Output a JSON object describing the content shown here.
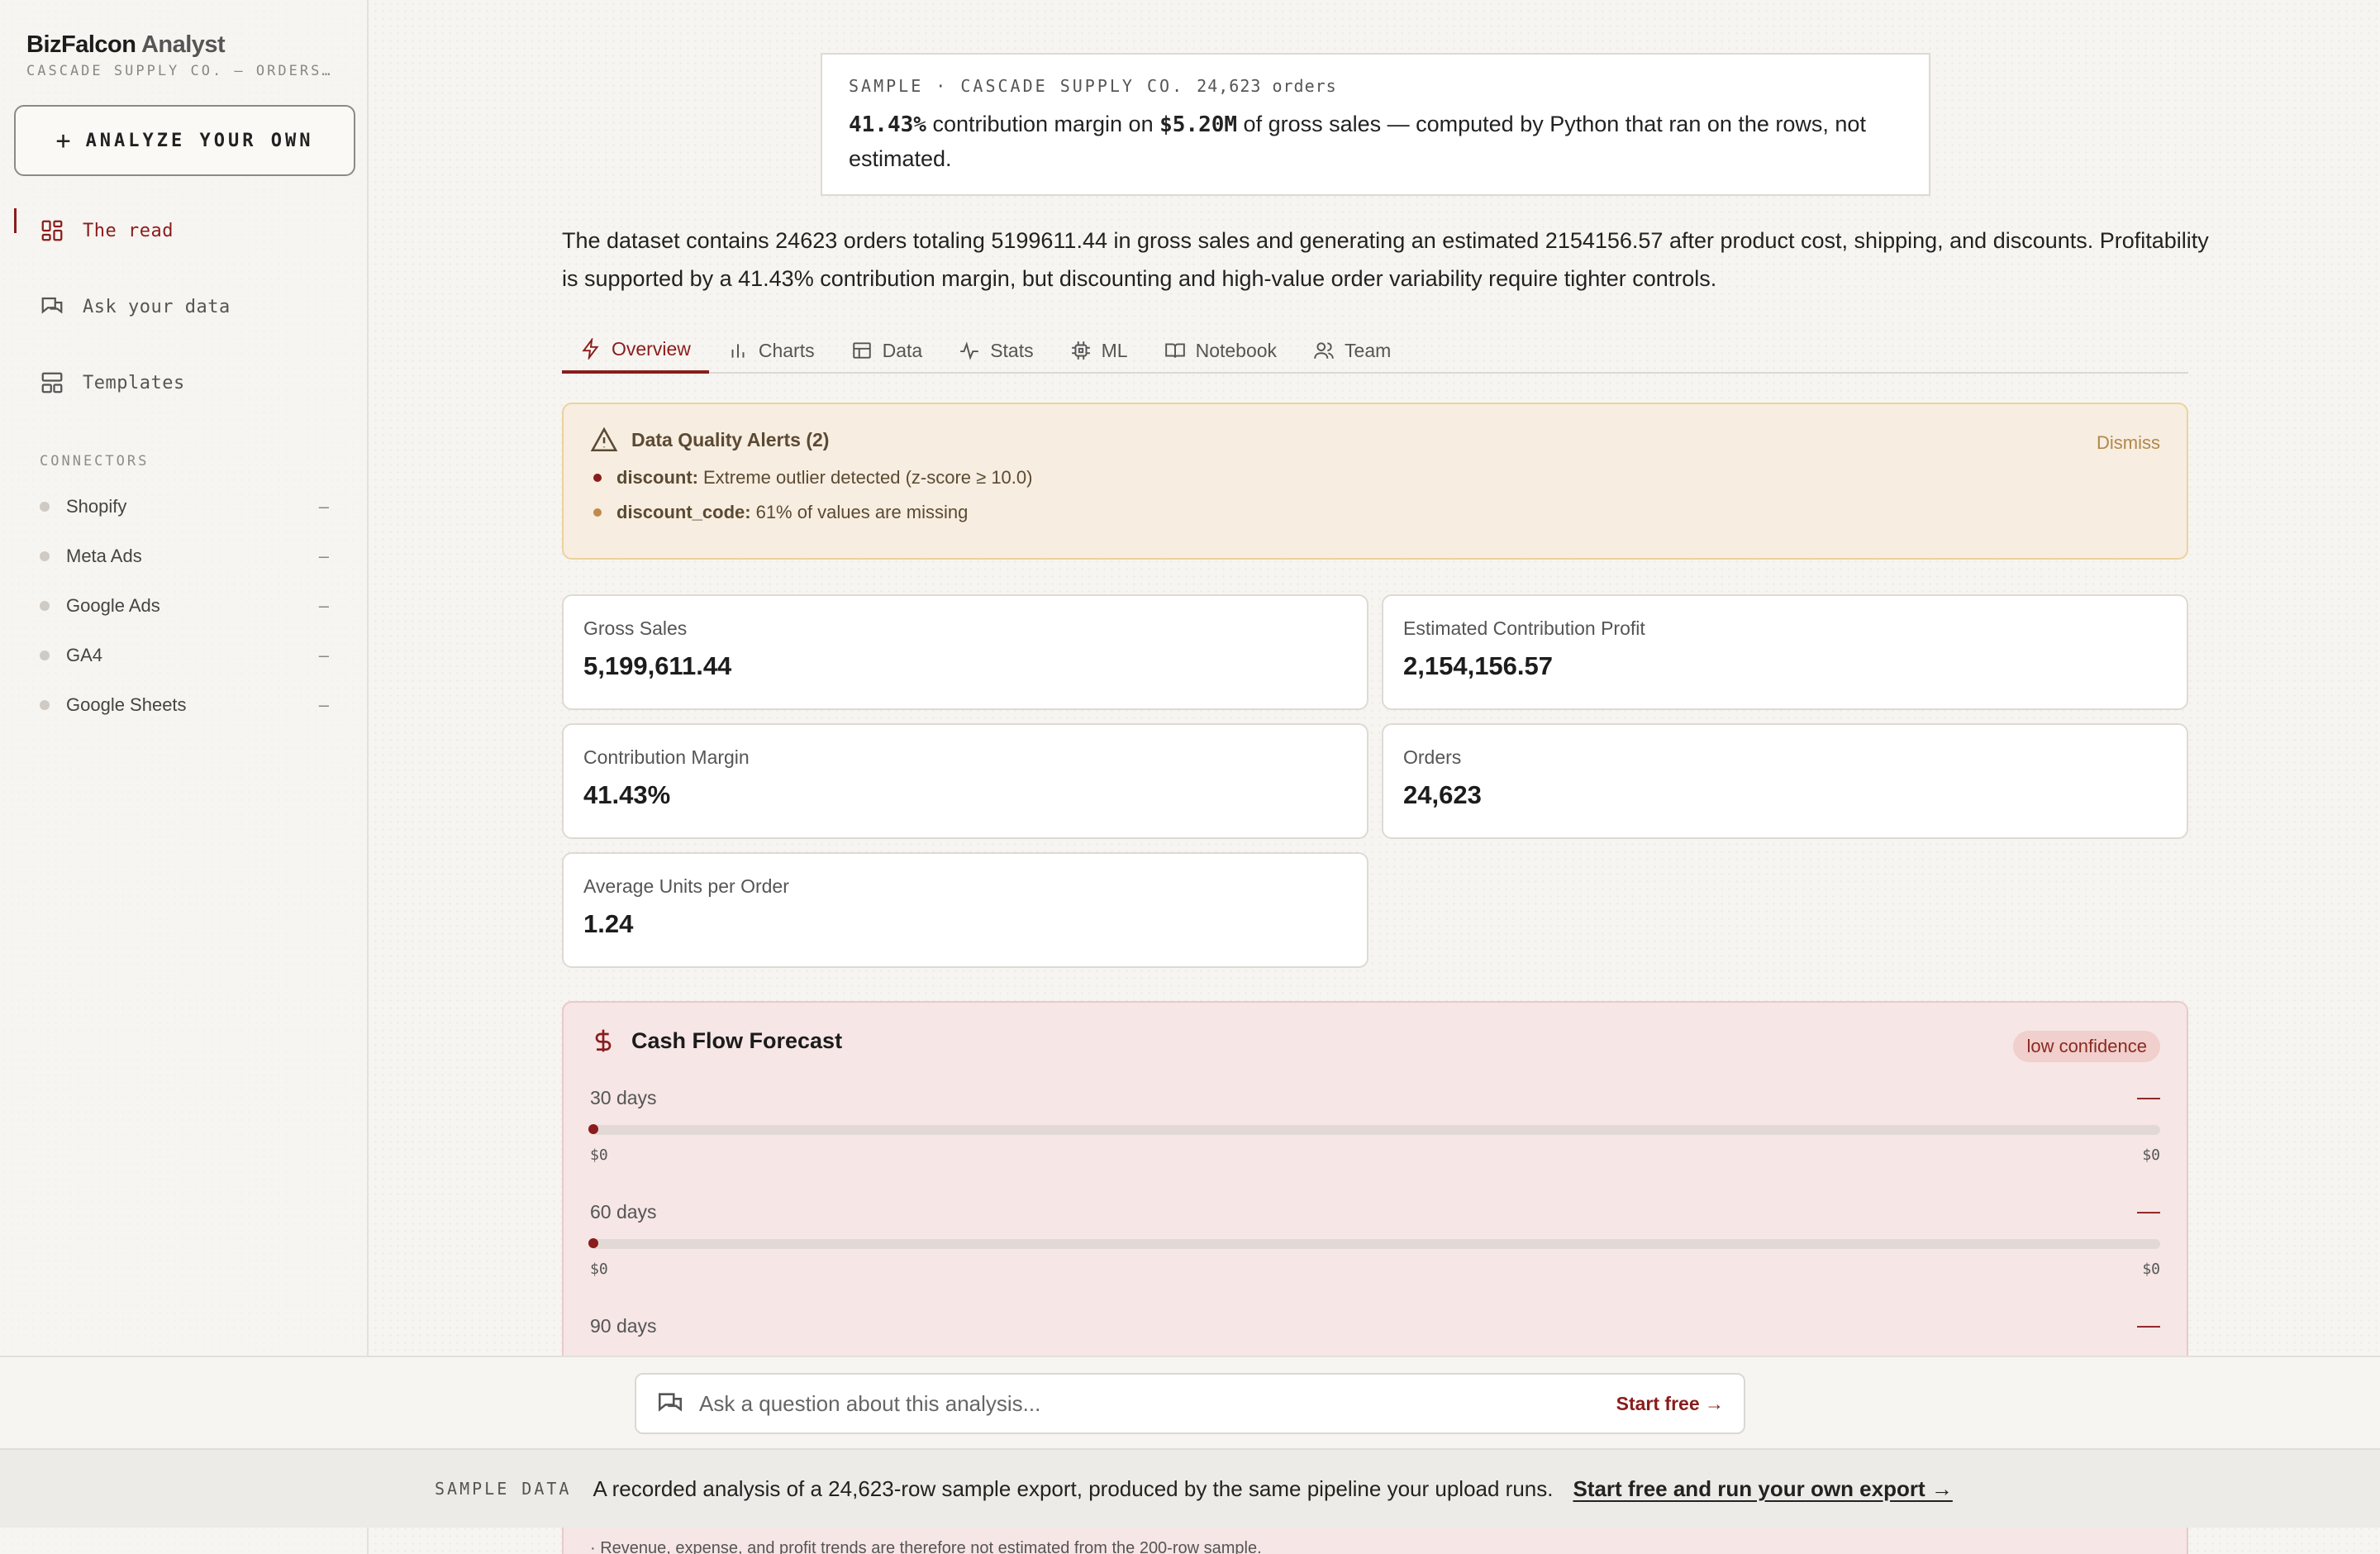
{
  "sidebar": {
    "brand_bold": "BizFalcon",
    "brand_light": "Analyst",
    "subtitle": "CASCADE SUPPLY CO. — ORDERS…",
    "analyze_label": "ANALYZE YOUR OWN",
    "nav": [
      {
        "label": "The read",
        "icon": "grid-icon",
        "active": true
      },
      {
        "label": "Ask your data",
        "icon": "chat-icon",
        "active": false
      },
      {
        "label": "Templates",
        "icon": "templates-icon",
        "active": false
      }
    ],
    "connectors_title": "CONNECTORS",
    "connectors": [
      {
        "name": "Shopify",
        "status": "–"
      },
      {
        "name": "Meta Ads",
        "status": "–"
      },
      {
        "name": "Google Ads",
        "status": "–"
      },
      {
        "name": "GA4",
        "status": "–"
      },
      {
        "name": "Google Sheets",
        "status": "–"
      }
    ]
  },
  "sample": {
    "head": "SAMPLE · CASCADE SUPPLY CO.",
    "count": "24,623 orders",
    "margin": "41.43%",
    "text1": "contribution margin on",
    "gross": "$5.20M",
    "text2": "of gross sales — computed by Python that ran on the rows, not estimated."
  },
  "summary": "The dataset contains 24623 orders totaling 5199611.44 in gross sales and generating an estimated 2154156.57 after product cost, shipping, and discounts. Profitability is supported by a 41.43% contribution margin, but discounting and high-value order variability require tighter controls.",
  "tabs": [
    {
      "label": "Overview",
      "icon": "bolt-icon",
      "active": true
    },
    {
      "label": "Charts",
      "icon": "bar-chart-icon",
      "active": false
    },
    {
      "label": "Data",
      "icon": "table-icon",
      "active": false
    },
    {
      "label": "Stats",
      "icon": "pulse-icon",
      "active": false
    },
    {
      "label": "ML",
      "icon": "chip-icon",
      "active": false
    },
    {
      "label": "Notebook",
      "icon": "book-icon",
      "active": false
    },
    {
      "label": "Team",
      "icon": "users-icon",
      "active": false
    }
  ],
  "alerts": {
    "title": "Data Quality Alerts (2)",
    "dismiss": "Dismiss",
    "items": [
      {
        "field": "discount:",
        "text": "Extreme outlier detected (z-score ≥ 10.0)",
        "color": "#8a1c1c"
      },
      {
        "field": "discount_code:",
        "text": "61% of values are missing",
        "color": "#c08a4a"
      }
    ]
  },
  "kpis": [
    {
      "label": "Gross Sales",
      "value": "5,199,611.44"
    },
    {
      "label": "Estimated Contribution Profit",
      "value": "2,154,156.57"
    },
    {
      "label": "Contribution Margin",
      "value": "41.43%"
    },
    {
      "label": "Orders",
      "value": "24,623"
    },
    {
      "label": "Average Units per Order",
      "value": "1.24"
    }
  ],
  "forecast": {
    "title": "Cash Flow Forecast",
    "confidence": "low confidence",
    "rows": [
      {
        "label": "30 days",
        "value": "—",
        "min": "$0",
        "max": "$0"
      },
      {
        "label": "60 days",
        "value": "—",
        "min": "$0",
        "max": "$0"
      },
      {
        "label": "90 days",
        "value": "—"
      }
    ]
  },
  "ask": {
    "placeholder": "Ask a question about this analysis...",
    "cta": "Start free →"
  },
  "banner": {
    "tag": "SAMPLE DATA",
    "text": "A recorded analysis of a 24,623-row sample export, produced by the same pipeline your upload runs.",
    "link": "Start free and run your own export →"
  },
  "footnote": "· Revenue, expense, and profit trends are therefore not estimated from the 200-row sample.",
  "colors": {
    "accent": "#8a1c1c",
    "alert_bg": "#f7ede0",
    "forecast_bg": "#f6e6e5"
  }
}
